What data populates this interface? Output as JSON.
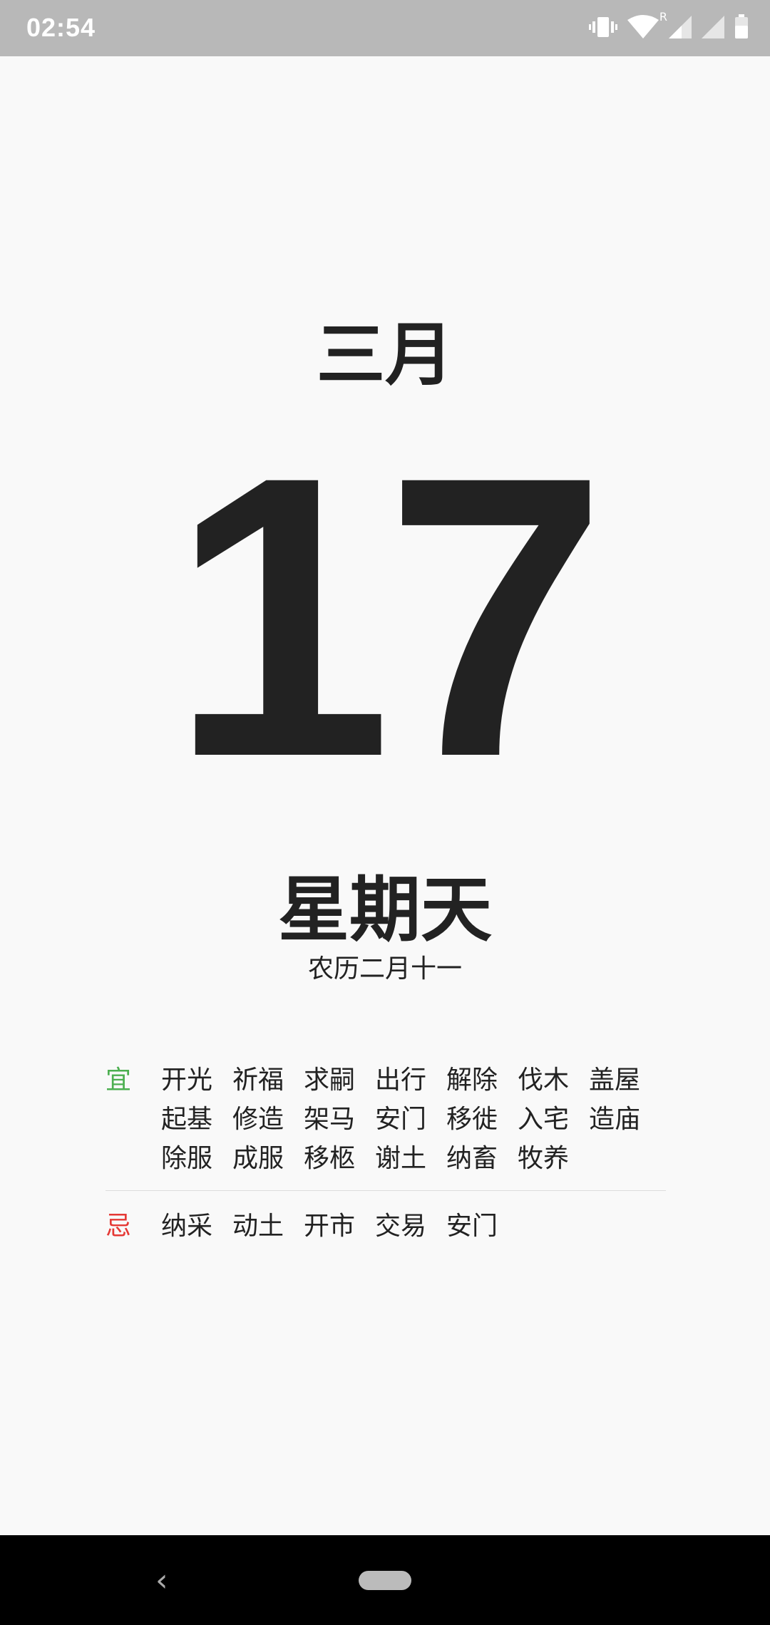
{
  "status_bar": {
    "time": "02:54",
    "icons": [
      "vibrate-icon",
      "wifi-icon",
      "signal-icon",
      "signal-icon",
      "battery-icon"
    ],
    "roaming_label": "R"
  },
  "calendar": {
    "month": "三月",
    "day": "17",
    "weekday": "星期天",
    "lunar_date": "农历二月十一"
  },
  "almanac": {
    "yi_label": "宜",
    "yi_color": "#4caf50",
    "yi_items": [
      "开光",
      "祈福",
      "求嗣",
      "出行",
      "解除",
      "伐木",
      "盖屋",
      "起基",
      "修造",
      "架马",
      "安门",
      "移徙",
      "入宅",
      "造庙",
      "除服",
      "成服",
      "移柩",
      "谢土",
      "纳畜",
      "牧养"
    ],
    "ji_label": "忌",
    "ji_color": "#e53935",
    "ji_items": [
      "纳采",
      "动土",
      "开市",
      "交易",
      "安门"
    ]
  },
  "nav_bar": {
    "icons": [
      "back-icon",
      "home-pill"
    ]
  }
}
